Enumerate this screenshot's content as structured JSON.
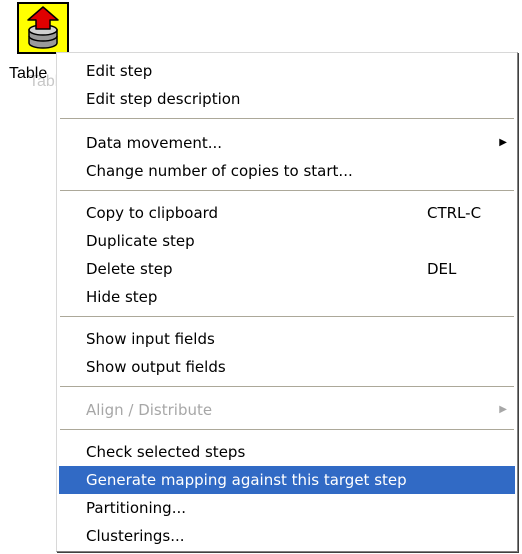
{
  "step": {
    "icon": "table-output-step-icon",
    "label": "Table",
    "label_ghost": "Table output"
  },
  "menu": {
    "items": [
      {
        "label": "Edit step"
      },
      {
        "label": "Edit step description"
      },
      {
        "label": "Data movement...",
        "submenu_icon": "submenu-arrow-icon"
      },
      {
        "label": "Change number of copies to start..."
      },
      {
        "label": "Copy to clipboard",
        "shortcut": "CTRL-C"
      },
      {
        "label": "Duplicate step"
      },
      {
        "label": "Delete step",
        "shortcut": "DEL"
      },
      {
        "label": "Hide step"
      },
      {
        "label": "Show input fields"
      },
      {
        "label": "Show output fields"
      },
      {
        "label": "Align / Distribute",
        "disabled": true,
        "submenu_icon": "submenu-arrow-icon"
      },
      {
        "label": "Check selected steps"
      },
      {
        "label": "Generate mapping against this target step",
        "highlighted": true
      },
      {
        "label": "Partitioning..."
      },
      {
        "label": "Clusterings..."
      }
    ]
  },
  "colors": {
    "highlight_bg": "#316ac5",
    "highlight_text": "#ffffff",
    "disabled_text": "#a7a7a7",
    "icon_yellow": "#ffff00",
    "icon_red": "#e00000",
    "icon_gray": "#a0a0a0"
  }
}
